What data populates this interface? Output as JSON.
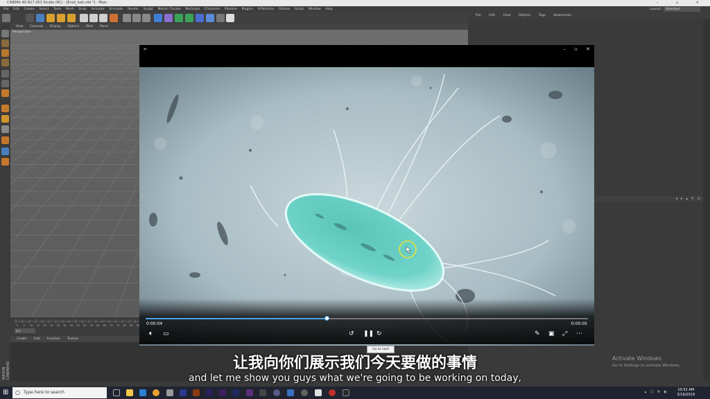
{
  "c4d": {
    "title": "CINEMA 4D R17.053 Studio (RC) - [Ecoli_ball.c4d *] - Main",
    "menu": [
      "File",
      "Edit",
      "Create",
      "Select",
      "Tools",
      "Mesh",
      "Snap",
      "Animate",
      "Simulate",
      "Render",
      "Sculpt",
      "Motion Tracker",
      "MoGraph",
      "Character",
      "Pipeline",
      "Plugins",
      "X-Particles",
      "Octane",
      "Script",
      "Window",
      "Help"
    ],
    "layout_label": "Layout:",
    "layout_value": "Standard",
    "view_menu": [
      "View",
      "Cameras",
      "Display",
      "Options",
      "Filter",
      "Panel"
    ],
    "viewport_label": "Perspective",
    "material_menu": [
      "Create",
      "Edit",
      "Function",
      "Texture"
    ],
    "object_menu": [
      "File",
      "Edit",
      "View",
      "Objects",
      "Tags",
      "Bookmarks"
    ],
    "timeline_ticks": [
      "0",
      "5",
      "10",
      "15",
      "20",
      "25",
      "30",
      "35",
      "40",
      "45",
      "50",
      "55",
      "60",
      "65",
      "70",
      "75",
      "80",
      "85",
      "90"
    ],
    "frame_field": "0 F",
    "activate_title": "Activate Windows",
    "activate_sub": "Go to Settings to activate Windows.",
    "maxon": "MAXON CINEMA4D"
  },
  "player": {
    "time_current": "0:00:04",
    "time_total": "0:00:05",
    "progress": 0.41,
    "tooltip": "Go to next frame",
    "icons": [
      "back-arrow",
      "minimize",
      "maximize",
      "close",
      "volume",
      "subtitles",
      "skip-back-10",
      "pause",
      "skip-forward-30",
      "draw",
      "mini-view",
      "fullscreen",
      "more"
    ]
  },
  "subtitles": {
    "zh": "让我向你们展示我们今天要做的事情",
    "en": "and let me show you guys what we're going to be working on today,"
  },
  "taskbar": {
    "search_placeholder": "Type here to search",
    "time": "10:52 AM",
    "date": "3/19/2019"
  },
  "colors": {
    "accent": "#4aa3e8",
    "bacterium": "#6fd3c9",
    "video_bg": "#b7c8ce",
    "cursor_ring": "#e6e03a"
  }
}
